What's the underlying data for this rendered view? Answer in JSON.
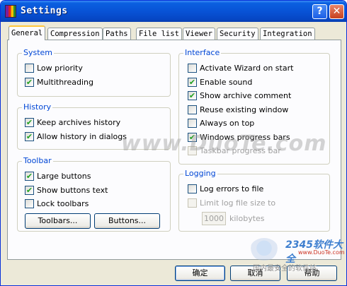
{
  "window": {
    "title": "Settings",
    "help_glyph": "?",
    "close_glyph": "✕"
  },
  "tabs": [
    {
      "label": "General",
      "active": true
    },
    {
      "label": "Compression"
    },
    {
      "label": "Paths"
    },
    {
      "label": "File list"
    },
    {
      "label": "Viewer"
    },
    {
      "label": "Security"
    },
    {
      "label": "Integration"
    }
  ],
  "system": {
    "title": "System",
    "options": [
      {
        "label": "Low priority",
        "checked": false
      },
      {
        "label": "Multithreading",
        "checked": true
      }
    ]
  },
  "history": {
    "title": "History",
    "options": [
      {
        "label": "Keep archives history",
        "checked": true
      },
      {
        "label": "Allow history in dialogs",
        "checked": true
      }
    ]
  },
  "toolbar": {
    "title": "Toolbar",
    "options": [
      {
        "label": "Large buttons",
        "checked": true
      },
      {
        "label": "Show buttons text",
        "checked": true
      },
      {
        "label": "Lock toolbars",
        "checked": false
      }
    ],
    "toolbars_button": "Toolbars...",
    "buttons_button": "Buttons..."
  },
  "interface": {
    "title": "Interface",
    "options": [
      {
        "label": "Activate Wizard on start",
        "checked": false
      },
      {
        "label": "Enable sound",
        "checked": true
      },
      {
        "label": "Show archive comment",
        "checked": true
      },
      {
        "label": "Reuse existing window",
        "checked": false
      },
      {
        "label": "Always on top",
        "checked": false
      },
      {
        "label": "Windows progress bars",
        "checked": true
      },
      {
        "label": "Taskbar progress bar",
        "checked": false,
        "disabled": true
      }
    ]
  },
  "logging": {
    "title": "Logging",
    "options": [
      {
        "label": "Log errors to file",
        "checked": false
      },
      {
        "label": "Limit log file size to",
        "checked": false,
        "disabled": true
      }
    ],
    "size_value": "1000",
    "size_unit": "kilobytes"
  },
  "footer": {
    "ok": "确定",
    "cancel": "取消",
    "help": "帮助"
  },
  "watermarks": {
    "main": "www.DuoTe.com",
    "brand": "2345软件大全",
    "brand_url": "www.DuoTe.com",
    "brand_slogan": "国内最安全的软件站"
  }
}
